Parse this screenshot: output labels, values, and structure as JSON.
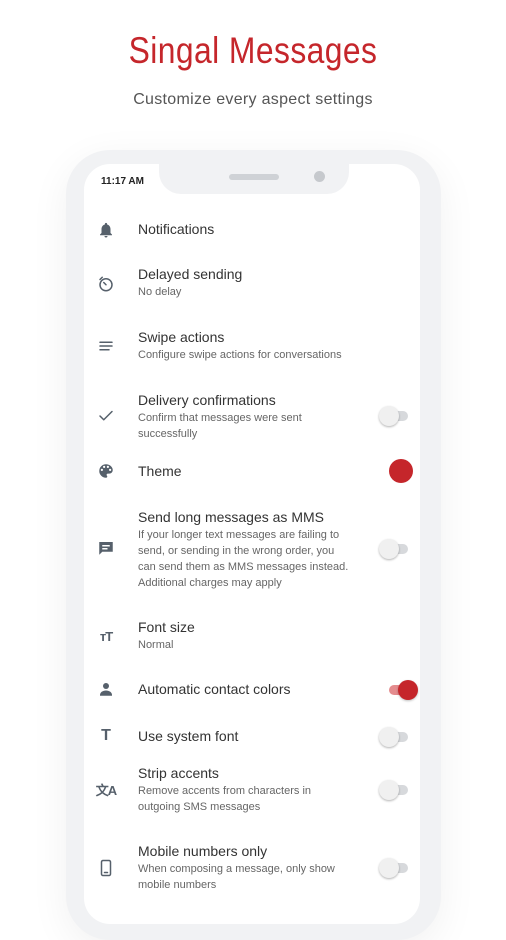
{
  "header": {
    "title": "Singal Messages",
    "subtitle": "Customize every aspect settings"
  },
  "status_bar": {
    "time": "11:17 AM"
  },
  "colors": {
    "accent": "#c5262b",
    "icon": "#56606b"
  },
  "settings": [
    {
      "title": "Notifications",
      "subtitle": "",
      "icon": "bell-icon"
    },
    {
      "title": "Delayed sending",
      "subtitle": "No delay",
      "icon": "timer-icon"
    },
    {
      "title": "Swipe actions",
      "subtitle": "Configure swipe actions for conversations",
      "icon": "swipe-icon"
    },
    {
      "title": "Delivery confirmations",
      "subtitle": "Confirm that messages were sent successfully",
      "icon": "check-icon",
      "toggle": false
    },
    {
      "title": "Theme",
      "subtitle": "",
      "icon": "palette-icon",
      "swatch": "#c5262b"
    },
    {
      "title": "Send long messages as MMS",
      "subtitle": "If your longer text messages are failing to send, or sending in the wrong order, you can send them as MMS messages instead. Additional charges may apply",
      "icon": "message-icon",
      "toggle": false
    },
    {
      "title": "Font size",
      "subtitle": "Normal",
      "icon": "text-size-icon"
    },
    {
      "title": "Automatic contact colors",
      "subtitle": "",
      "icon": "person-icon",
      "toggle": true
    },
    {
      "title": "Use system font",
      "subtitle": "",
      "icon": "text-icon",
      "toggle": false
    },
    {
      "title": "Strip accents",
      "subtitle": "Remove accents from characters in outgoing SMS messages",
      "icon": "translate-icon",
      "toggle": false
    },
    {
      "title": "Mobile numbers only",
      "subtitle": "When composing a message, only show mobile numbers",
      "icon": "phone-icon",
      "toggle": false
    }
  ]
}
